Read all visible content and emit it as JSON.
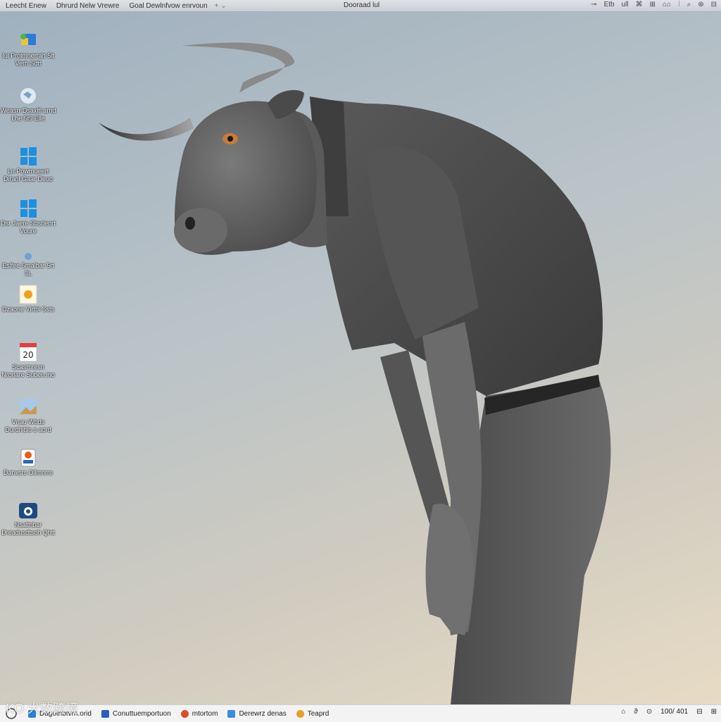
{
  "topbar": {
    "tabs": [
      "Leecht Enew",
      "Dhrurd Nelw Vrewre",
      "Goal Dewlnfvow enrvoun"
    ],
    "new_tab": "+  ⌄",
    "title": "Dooraad lul",
    "tools": [
      "⊸",
      "Etb",
      "ull",
      "⌘",
      "⊞",
      "⌂⌂",
      "⫶",
      "⌕",
      "⊛",
      "⊟"
    ]
  },
  "desktop_icons": [
    {
      "label": "Iul Prolmnerrah 5lt Verh    Sdtt",
      "icon": "network-folder-icon"
    },
    {
      "label": "Weasrr Dsaxltl arnd Lhe 5t9 Elle",
      "icon": "weather-map-icon"
    },
    {
      "label": "Ln Powrnueert Diranl Gaar Deuo",
      "icon": "windows-logo-icon"
    },
    {
      "label": "Dsr Jaere Sbsrlenrt Voure",
      "icon": "windows-logo-icon"
    },
    {
      "label": "Eslfee 5rnalbar 5rt 3L",
      "icon": "system-icon"
    },
    {
      "label": "Dzaone Vlrtbl Ssts",
      "icon": "sticky-note-icon"
    },
    {
      "label": "Scasrnresn Nrorlare Suben.ino",
      "icon": "calendar-icon"
    },
    {
      "label": "Vnau Wbds Durdhibls s aord",
      "icon": "photo-icon"
    },
    {
      "label": "Darwsrs Ollmnrre",
      "icon": "media-app-icon"
    },
    {
      "label": "Nsaltnbar Dreadusdtsoh Qhtt",
      "icon": "cloud-drive-icon"
    }
  ],
  "calendar_day": "20",
  "taskbar": {
    "tasks": [
      {
        "label": "Dagotnbtvrn.orid",
        "color": "#2f7fd6"
      },
      {
        "label": "Conuttuemportuon",
        "color": "#2b5fb8"
      },
      {
        "label": "mtortom",
        "color": "#e04b2a"
      },
      {
        "label": "Derewrz denas",
        "color": "#3c8cdc"
      },
      {
        "label": "Teaprd",
        "color": "#e8a020"
      }
    ],
    "tray": [
      "⌂",
      "ϑ",
      "⊙",
      "100/ 401",
      "⊟",
      "⊞"
    ]
  },
  "watermark": "KO 大数跨境",
  "colors": {
    "sky_top": "#9fb0be",
    "sky_bottom": "#e9dcc5",
    "shirt": "#4a4a4a",
    "pants": "#5a5a5a",
    "skin": "#6d6d6d",
    "horn": "#9a9a9a"
  }
}
